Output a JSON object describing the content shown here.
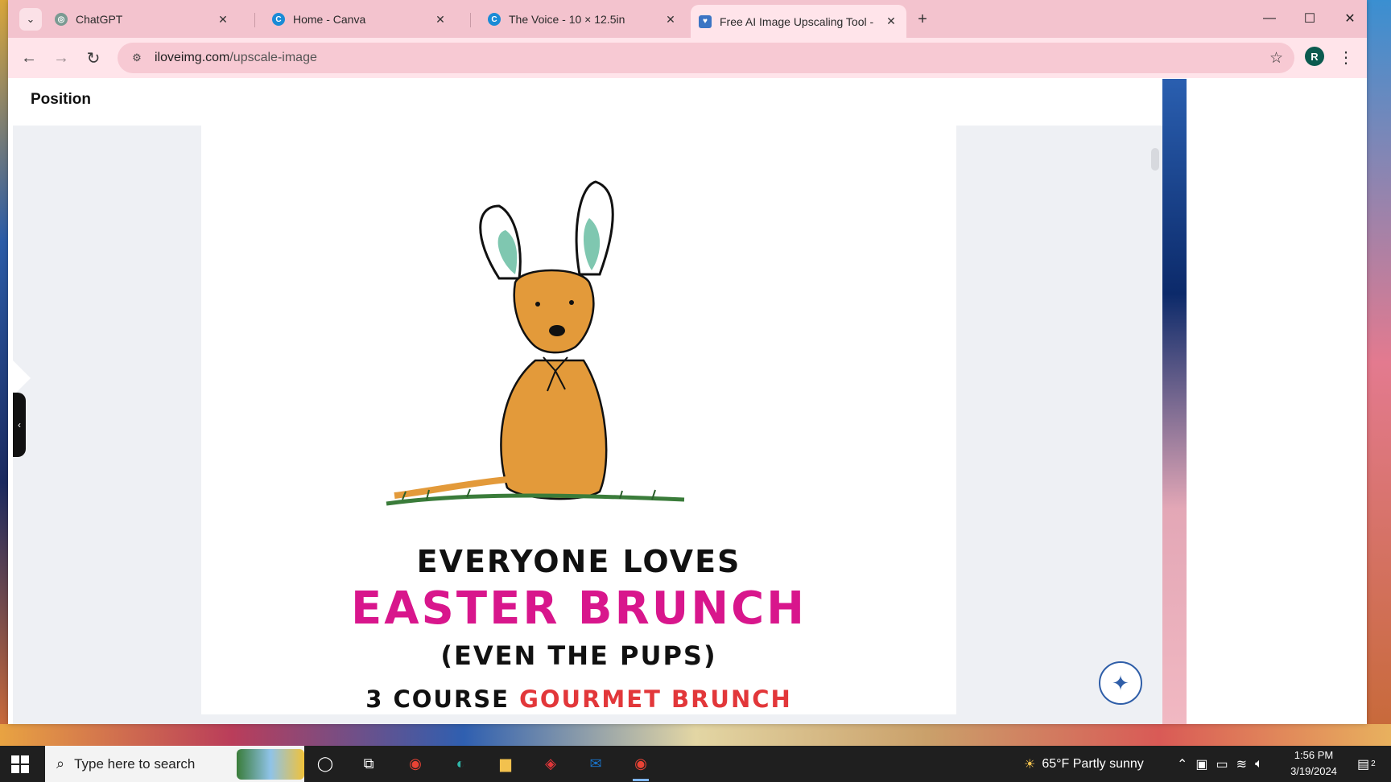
{
  "browser": {
    "tabs": [
      {
        "label": "ChatGPT",
        "close": "✕"
      },
      {
        "label": "Home - Canva",
        "close": "✕"
      },
      {
        "label": "The Voice - 10 × 12.5in",
        "close": "✕"
      },
      {
        "label": "Free AI Image Upscaling Tool -",
        "close": "✕"
      }
    ],
    "new_tab": "+",
    "url_domain": "iloveimg.com",
    "url_path": "/upscale-image",
    "profile_initial": "R"
  },
  "editor": {
    "title": "Position"
  },
  "design": {
    "line1": "EVERYONE LOVES",
    "line2": "EASTER BRUNCH",
    "line3": "(EVEN THE PUPS)",
    "line4a": "3 COURSE ",
    "line4b": "GOURMET BRUNCH",
    "colors": {
      "pink": "#d8168c",
      "red": "#e2373a",
      "dog": "#e39a3a",
      "ears": "#7fc7b0"
    }
  },
  "taskbar": {
    "search_placeholder": "Type here to search",
    "weather": "65°F  Partly sunny",
    "time": "1:56 PM",
    "date": "3/19/2024",
    "notification_count": "2"
  }
}
